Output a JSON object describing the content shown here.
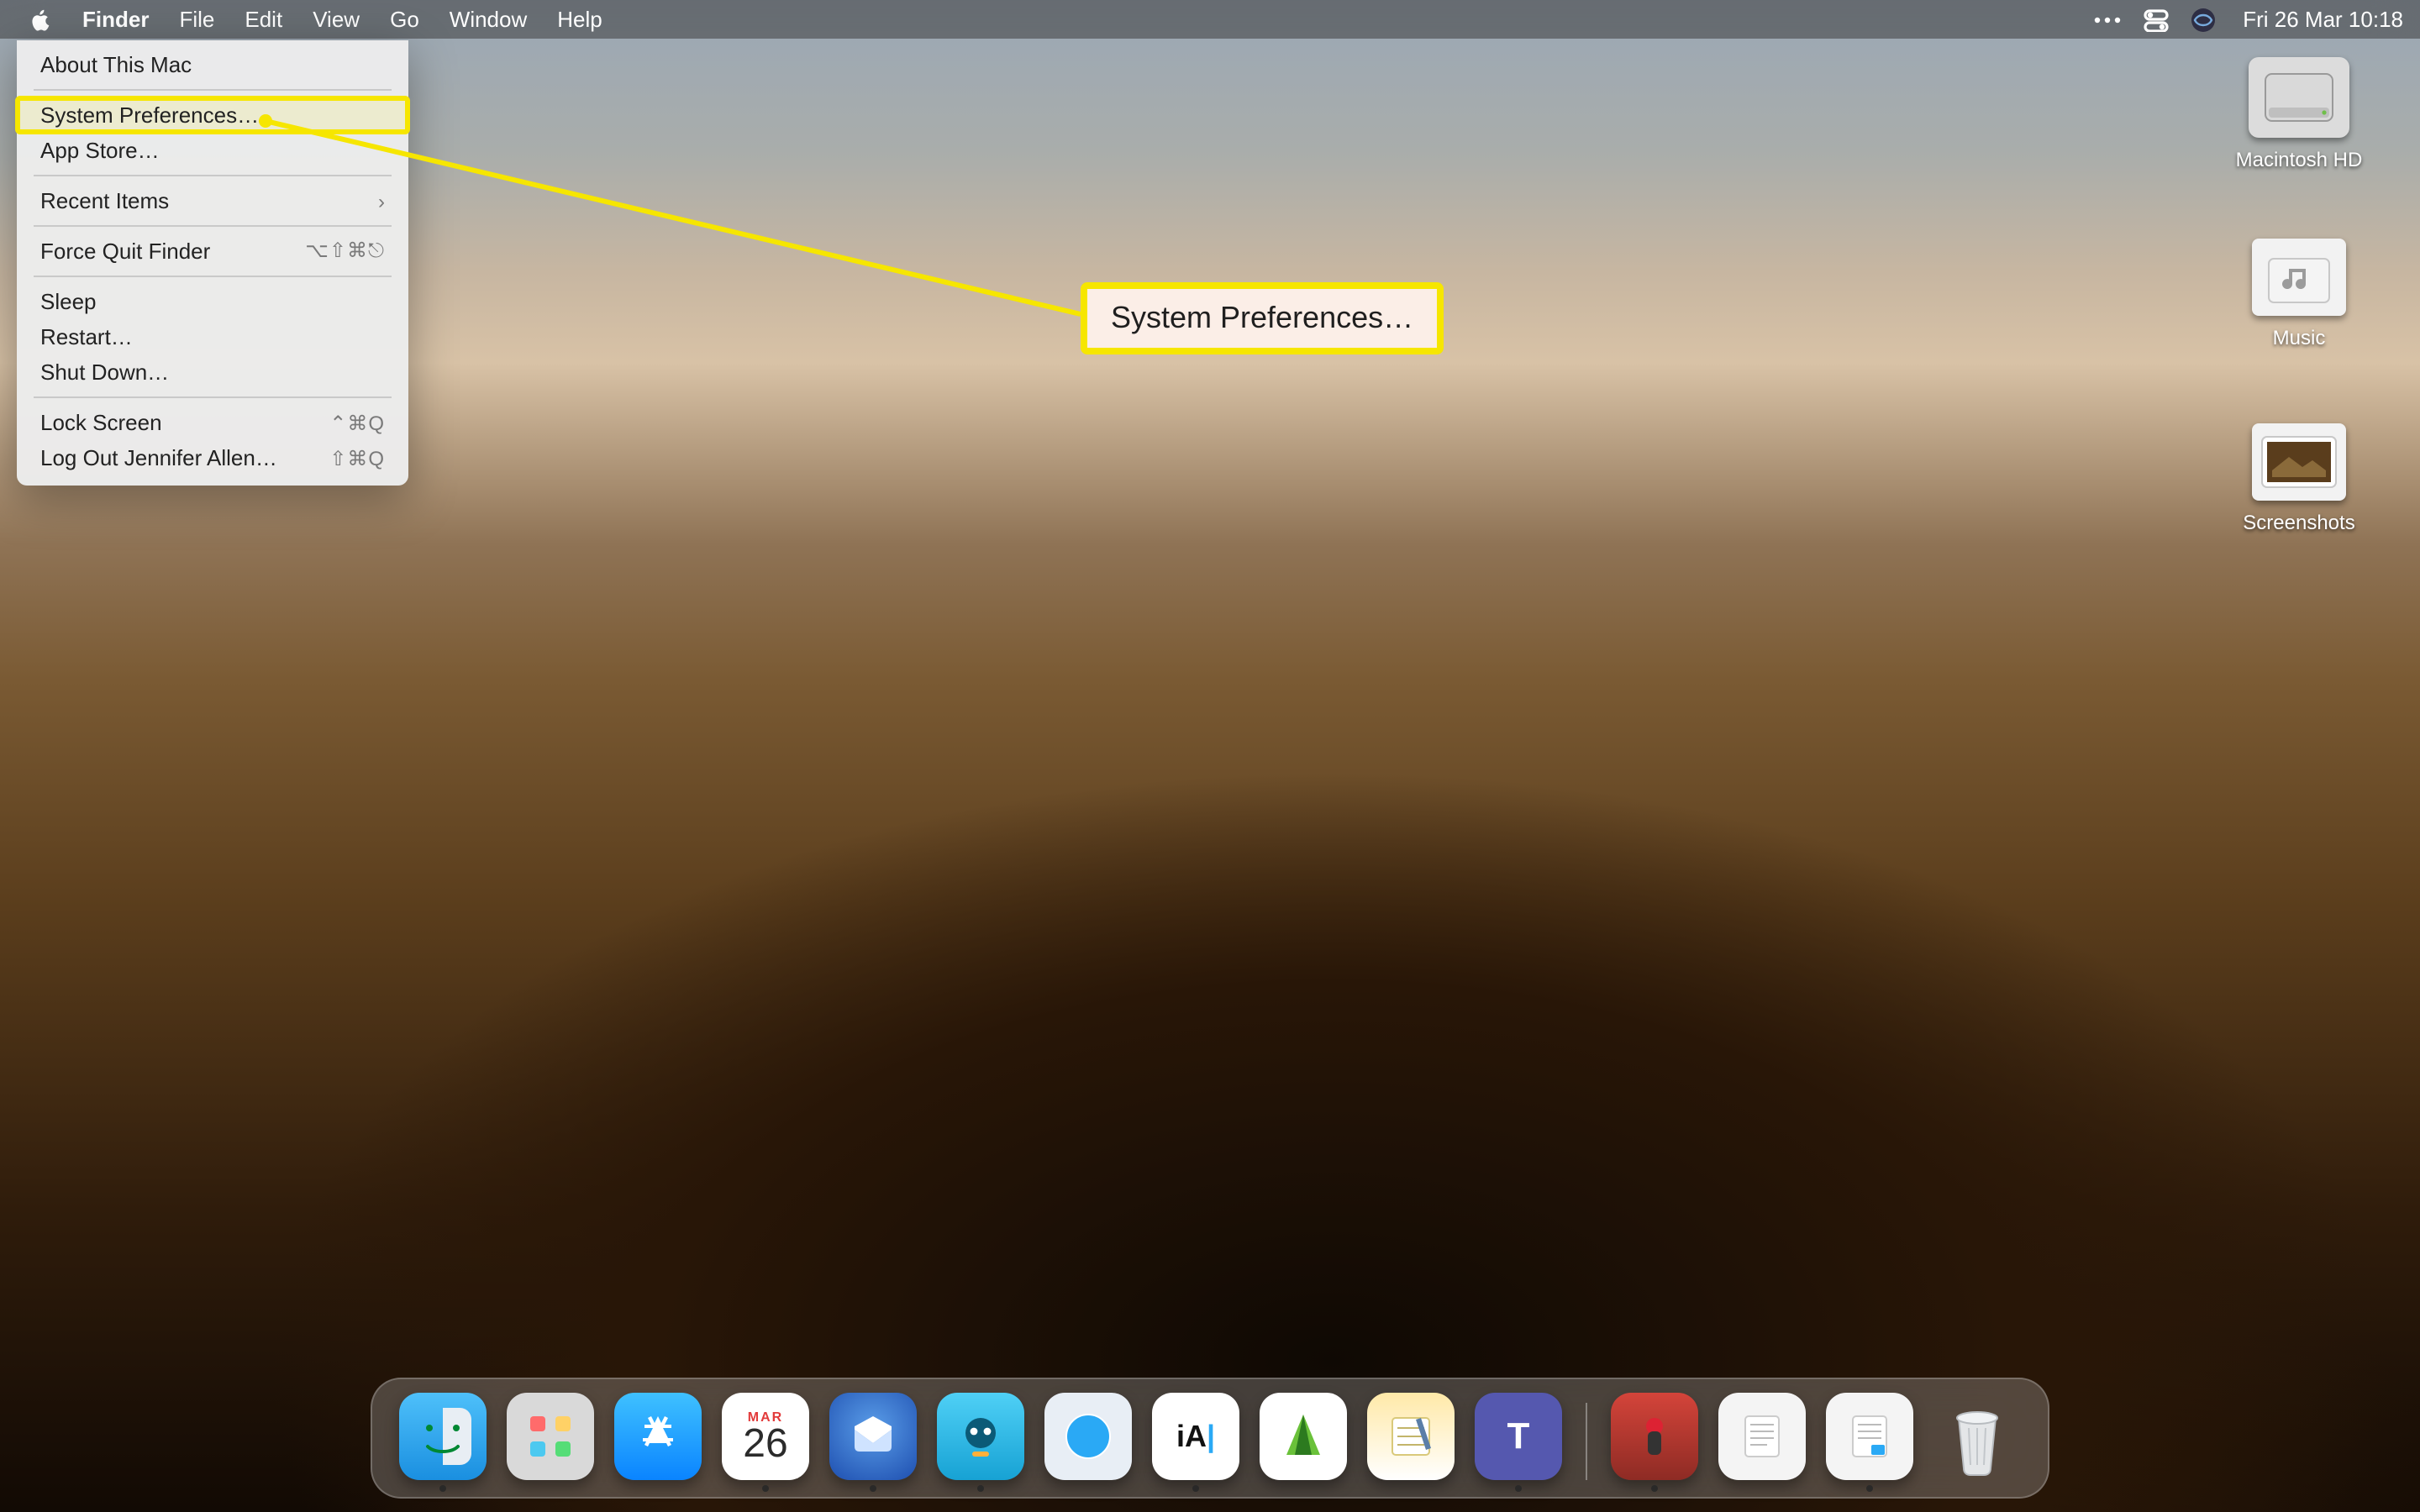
{
  "menubar": {
    "app_name": "Finder",
    "items": [
      "File",
      "Edit",
      "View",
      "Go",
      "Window",
      "Help"
    ],
    "clock": "Fri 26 Mar  10:18"
  },
  "apple_menu": {
    "about": "About This Mac",
    "sysprefs": "System Preferences…",
    "appstore": "App Store…",
    "recent": "Recent Items",
    "forcequit": "Force Quit Finder",
    "forcequit_shortcut": "⌥⇧⌘⎋",
    "sleep": "Sleep",
    "restart": "Restart…",
    "shutdown": "Shut Down…",
    "lock": "Lock Screen",
    "lock_shortcut": "⌃⌘Q",
    "logout": "Log Out Jennifer Allen…",
    "logout_shortcut": "⇧⌘Q"
  },
  "callout": {
    "text": "System Preferences…"
  },
  "desktop": {
    "hd": "Macintosh HD",
    "music": "Music",
    "screenshots": "Screenshots"
  },
  "dock": {
    "calendar_month": "MAR",
    "calendar_day": "26",
    "apps": [
      {
        "name": "finder",
        "bg": "#2aa9f5",
        "running": true
      },
      {
        "name": "launchpad",
        "bg": "#e8e8e8"
      },
      {
        "name": "app-store",
        "bg": "#1fa5ff"
      },
      {
        "name": "calendar",
        "bg": "#ffffff",
        "running": true
      },
      {
        "name": "thunderbird",
        "bg": "#2b62c8",
        "running": true
      },
      {
        "name": "tweetbot",
        "bg": "#35b7e4",
        "running": true
      },
      {
        "name": "safari",
        "bg": "#e7eef5"
      },
      {
        "name": "ia-writer",
        "bg": "#ffffff",
        "running": true
      },
      {
        "name": "komoot",
        "bg": "#6ac13a"
      },
      {
        "name": "notes",
        "bg": "#fff6d3"
      },
      {
        "name": "teams",
        "bg": "#5558af",
        "running": true
      }
    ],
    "right": [
      {
        "name": "openemu",
        "bg": "#c23a2e",
        "running": true
      },
      {
        "name": "document-1",
        "bg": "#f4f4f4"
      },
      {
        "name": "document-2",
        "bg": "#f4f4f4",
        "running": true
      },
      {
        "name": "trash",
        "bg": "transparent"
      }
    ]
  }
}
